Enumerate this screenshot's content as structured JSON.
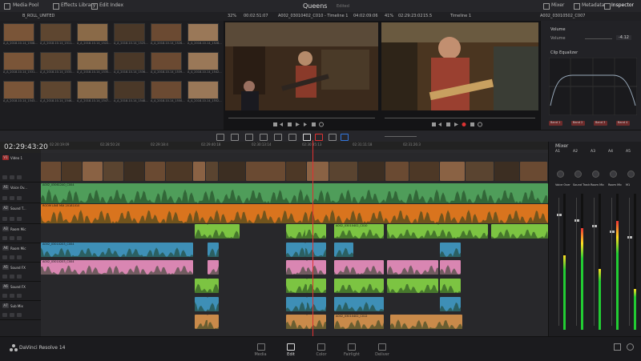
{
  "topbar": {
    "media_pool": "Media Pool",
    "effects_library": "Effects Library",
    "edit_index": "Edit Index",
    "project_name": "Queens",
    "project_status": "Edited",
    "mixer": "Mixer",
    "metadata": "Metadata",
    "inspector": "Inspector"
  },
  "row2": {
    "bin_name": "B_ROLL_UNITED",
    "zoom_left": "32%",
    "tc_left": "00:02:51:07",
    "clip_left": "A002_03010402_C010 - Timeline 1",
    "tc_mid": "04:02:09:06",
    "zoom_right": "41%",
    "tc_right": "02:29:23:02",
    "fps": "15.5",
    "timeline_name": "Timeline 1",
    "clip_right": "A002_03010502_C007"
  },
  "pool_labels": [
    "A_A_2018-10-14_1508...",
    "A_A_2018-10-14_1511...",
    "A_A_2018-10-14_1522...",
    "A_A_2018-10-14_1525...",
    "A_A_2018-10-14_1526...",
    "A_A_2018-10-14_1528...",
    "A_A_2018-10-14_1531...",
    "A_A_2018-10-14_1533...",
    "A_A_2018-10-14_1535...",
    "A_A_2018-10-14_1536...",
    "A_A_2018-10-14_1539...",
    "A_A_2018-10-14_1542...",
    "A_A_2018-10-14_1543...",
    "A_A_2018-10-14_1546...",
    "A_A_2018-10-14_1547...",
    "A_A_2018-10-14_1548...",
    "A_A_2018-10-14_1550...",
    "A_A_2018-10-14_1552..."
  ],
  "inspector": {
    "volume_label": "Volume",
    "volume_field": "Volume",
    "volume_value": "-4.12",
    "eq_label": "Clip Equalizer",
    "bands": [
      "Band 1",
      "Band 2",
      "Band 3",
      "Band 4"
    ]
  },
  "timeline": {
    "current_tc": "02:29:43:20",
    "ruler": [
      "02:20:19:09",
      "02:28:50:24",
      "02:29:18:4",
      "02:29:40:18",
      "02:30:13:14",
      "02:30:35:13",
      "02:31:11:18",
      "02:31:26:3"
    ],
    "tracks": [
      {
        "badge": "V1",
        "name": "Video 1"
      },
      {
        "badge": "A1",
        "name": "Voice Ov..."
      },
      {
        "badge": "A2",
        "name": "Sound T..."
      },
      {
        "badge": "A3",
        "name": "Room Mic"
      },
      {
        "badge": "A4",
        "name": "Room Mic"
      },
      {
        "badge": "A5",
        "name": "Sound FX"
      },
      {
        "badge": "A6",
        "name": "Sound FX"
      },
      {
        "badge": "A7",
        "name": "Sub Mix"
      }
    ],
    "clip_names": {
      "voice": "A002_03061240_C004",
      "sound": "ROOM LINE MIX 20181010",
      "green": "A002_03010402_C010",
      "blue": "A002_03010203_C004",
      "pink": "A002_03010203_C004",
      "orange": "A002_03010402_C012"
    }
  },
  "mixer": {
    "title": "Mixer",
    "channels": [
      "A1",
      "A2",
      "A3",
      "A4",
      "A5"
    ],
    "channel_names": [
      "Voice Over",
      "Sound Track",
      "Room Mic",
      "Room Mic",
      "M1"
    ],
    "levels": [
      0.55,
      0.75,
      0.45,
      0.8,
      0.3
    ]
  },
  "bottom": {
    "app_name": "DaVinci Resolve 14",
    "pages": [
      "Media",
      "Edit",
      "Color",
      "Fairlight",
      "Deliver"
    ]
  },
  "colors": {
    "voice_clip": "#4f9d5a",
    "sound_clip": "#d9741e",
    "green_clip": "#7cc442",
    "blue_clip": "#3e8fb6",
    "pink_clip": "#d986b2",
    "orange_clip": "#c98a4a",
    "playhead": "#e03030"
  }
}
